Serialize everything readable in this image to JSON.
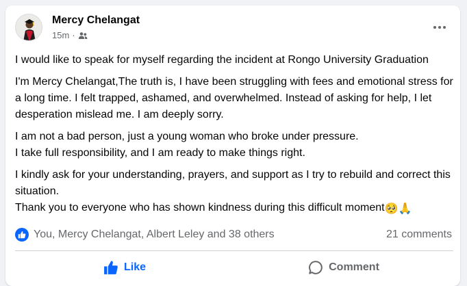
{
  "post": {
    "author": "Mercy Chelangat",
    "timestamp": "15m",
    "separator": "·",
    "audience_icon": "friends-icon",
    "more_icon": "more-dots-icon",
    "paragraphs": [
      "I would like to speak for myself regarding the incident at Rongo University Graduation",
      "I'm Mercy Chelangat,The truth is, I have been struggling with fees and emotional stress for a long time. I felt trapped, ashamed, and overwhelmed. Instead of asking for help, I let desperation mislead me. I am deeply sorry.",
      "I am not a bad person, just a young woman who broke under pressure.\nI take full responsibility, and I am ready to make things right.",
      "I kindly ask for your understanding, prayers, and support as I try to rebuild and correct this situation.\nThank you to everyone who has shown kindness during this difficult moment"
    ],
    "closing_emojis": [
      "🥺",
      "🙏"
    ]
  },
  "reactions": {
    "icon": "like-reaction-icon",
    "summary": "You, Mercy Chelangat, Albert Leley and 38 others",
    "comments": "21 comments"
  },
  "actions": {
    "like_label": "Like",
    "like_icon": "thumbs-up-icon",
    "comment_label": "Comment",
    "comment_icon": "comment-bubble-icon"
  },
  "colors": {
    "accent": "#0866ff",
    "secondary_text": "#65676b",
    "primary_text": "#050505"
  }
}
